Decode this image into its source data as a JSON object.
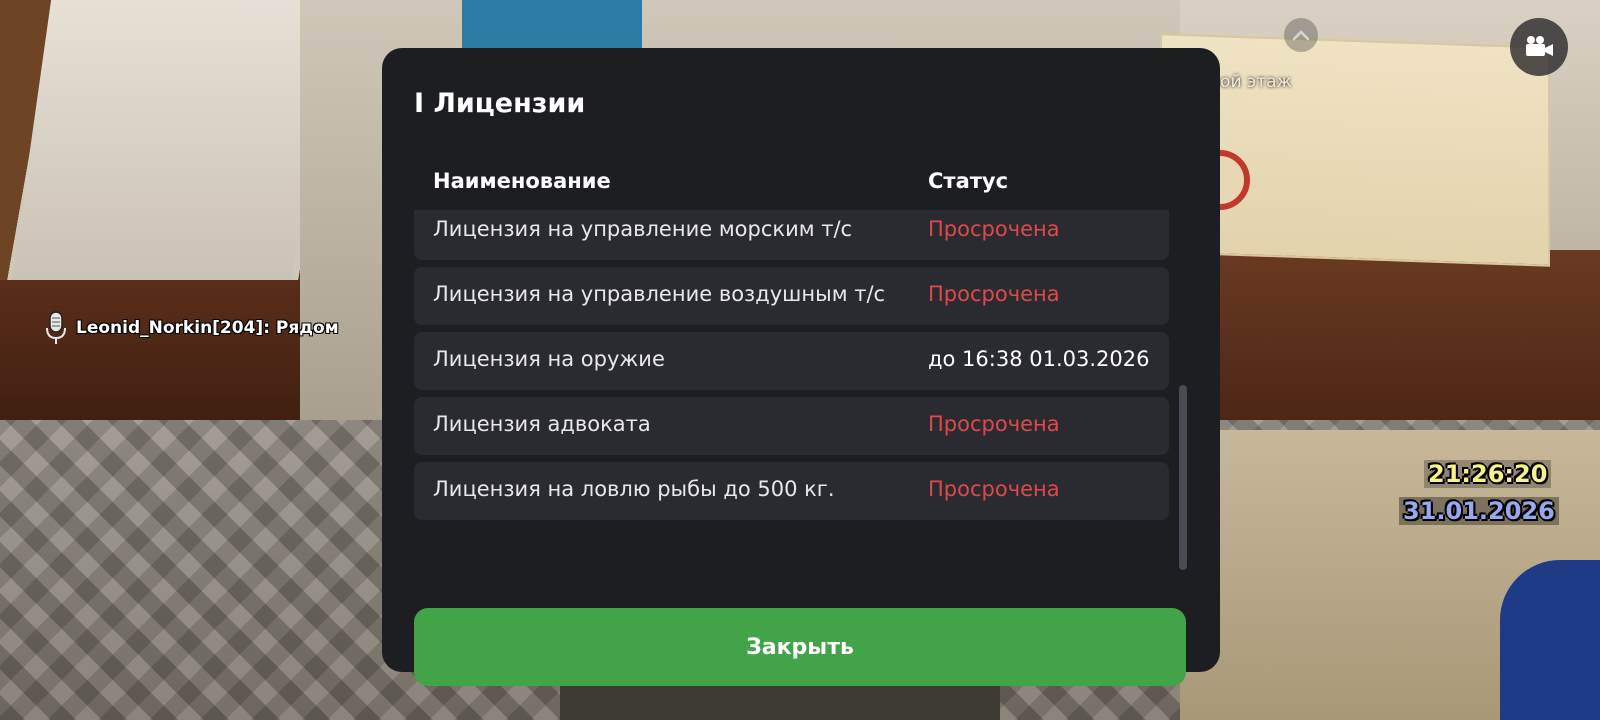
{
  "scene": {
    "poster_text": "на второй этаж"
  },
  "hud": {
    "chat_message": "Leonid_Norkin[204]: Рядом",
    "time": "21:26:20",
    "date": "31.01.2026",
    "icons": {
      "mic": "microphone-icon",
      "camera": "video-camera-icon",
      "up": "chevron-up-icon"
    }
  },
  "modal": {
    "title": "I Лицензии",
    "columns": {
      "name": "Наименование",
      "status": "Статус"
    },
    "rows": [
      {
        "name": "Лицензия на управление морским т/с",
        "status": "Просрочена",
        "state": "expired"
      },
      {
        "name": "Лицензия на управление воздушным т/с",
        "status": "Просрочена",
        "state": "expired"
      },
      {
        "name": "Лицензия на оружие",
        "status": "до 16:38 01.03.2026",
        "state": "valid"
      },
      {
        "name": "Лицензия адвоката",
        "status": "Просрочена",
        "state": "expired"
      },
      {
        "name": "Лицензия на ловлю рыбы до 500 кг.",
        "status": "Просрочена",
        "state": "expired"
      }
    ],
    "close_label": "Закрыть"
  },
  "colors": {
    "modal_bg": "#1d1e22",
    "row_bg": "#2a2b31",
    "expired": "#e0484a",
    "accent_green": "#43a349",
    "clock": "#f7f28a",
    "date": "#98a8f0"
  }
}
